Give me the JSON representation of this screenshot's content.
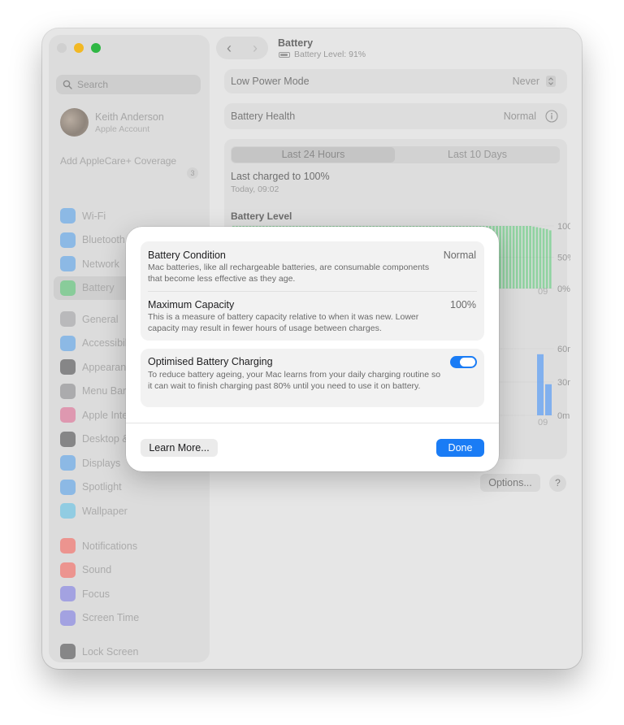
{
  "window": {
    "title": "Battery",
    "subtitle": "Battery Level: 91%"
  },
  "sidebar": {
    "search_placeholder": "Search",
    "account": {
      "name": "Keith Anderson",
      "subtitle": "Apple Account"
    },
    "applecare": {
      "label": "Add AppleCare+ Coverage",
      "badge": "3"
    },
    "groups": [
      [
        {
          "label": "Wi-Fi",
          "icon": "wifi-icon",
          "color": "#2b8ff0"
        },
        {
          "label": "Bluetooth",
          "icon": "bluetooth-icon",
          "color": "#2b8ff0"
        },
        {
          "label": "Network",
          "icon": "network-icon",
          "color": "#2b8ff0"
        },
        {
          "label": "Battery",
          "icon": "battery-icon",
          "color": "#33c759",
          "selected": true
        }
      ],
      [
        {
          "label": "General",
          "icon": "gear-icon",
          "color": "#8e8e93"
        },
        {
          "label": "Accessibility",
          "icon": "accessibility-icon",
          "color": "#2b8ff0"
        },
        {
          "label": "Appearance",
          "icon": "appearance-icon",
          "color": "#1c1c1e"
        },
        {
          "label": "Menu Bar",
          "icon": "menu-bar-icon",
          "color": "#6e6e73"
        },
        {
          "label": "Apple Intelligence & Siri",
          "icon": "siri-icon",
          "color": "#e0457b"
        },
        {
          "label": "Desktop & Dock",
          "icon": "desktop-dock-icon",
          "color": "#1c1c1e"
        },
        {
          "label": "Displays",
          "icon": "displays-icon",
          "color": "#2b8ff0"
        },
        {
          "label": "Spotlight",
          "icon": "spotlight-icon",
          "color": "#2b8ff0"
        },
        {
          "label": "Wallpaper",
          "icon": "wallpaper-icon",
          "color": "#35b7e8"
        }
      ],
      [
        {
          "label": "Notifications",
          "icon": "notifications-icon",
          "color": "#ff3b30"
        },
        {
          "label": "Sound",
          "icon": "sound-icon",
          "color": "#ff3b30"
        },
        {
          "label": "Focus",
          "icon": "focus-icon",
          "color": "#5e5ce6"
        },
        {
          "label": "Screen Time",
          "icon": "screen-time-icon",
          "color": "#5e5ce6"
        }
      ],
      [
        {
          "label": "Lock Screen",
          "icon": "lock-icon",
          "color": "#1c1c1e"
        }
      ]
    ]
  },
  "main": {
    "low_power": {
      "label": "Low Power Mode",
      "value": "Never"
    },
    "health": {
      "label": "Battery Health",
      "value": "Normal"
    },
    "tabs": [
      "Last 24 Hours",
      "Last 10 Days"
    ],
    "last_charged": {
      "label": "Last charged to 100%",
      "time": "Today, 09:02"
    },
    "battery_level_title": "Battery Level",
    "options_button": "Options...",
    "help_button": "?"
  },
  "chart_data": [
    {
      "type": "bar",
      "title": "Battery Level",
      "y_tick_labels": [
        "100%",
        "50%",
        "0%"
      ],
      "ylim": [
        0,
        100
      ],
      "x_tick_labels": [
        "09"
      ],
      "color": "#34c759",
      "x": [
        0,
        1,
        2,
        3,
        4,
        5,
        6,
        7,
        8,
        9,
        10,
        11,
        12,
        13,
        14,
        15,
        16,
        17,
        18,
        19,
        20,
        21,
        22,
        23,
        24,
        25,
        26,
        27,
        28,
        29,
        30,
        31,
        32,
        33,
        34,
        35,
        36,
        37,
        38,
        39,
        40,
        41,
        42,
        43,
        44,
        45,
        46,
        47,
        48,
        49,
        50,
        51,
        52,
        53,
        54,
        55,
        56,
        57,
        58,
        59,
        60,
        61,
        62,
        63,
        64,
        65,
        66,
        67,
        68,
        69,
        70,
        71,
        72,
        73,
        74,
        75,
        76,
        77,
        78,
        79,
        80,
        81,
        82,
        83,
        84,
        85,
        86,
        87,
        88,
        89,
        90,
        91,
        92,
        93,
        94,
        95
      ],
      "values": [
        100,
        100,
        100,
        100,
        100,
        100,
        100,
        100,
        100,
        100,
        100,
        100,
        100,
        100,
        100,
        100,
        100,
        100,
        100,
        100,
        100,
        100,
        100,
        100,
        100,
        100,
        100,
        100,
        100,
        100,
        100,
        100,
        100,
        100,
        100,
        100,
        100,
        100,
        100,
        100,
        100,
        100,
        100,
        100,
        100,
        100,
        100,
        100,
        100,
        100,
        100,
        100,
        100,
        100,
        100,
        100,
        100,
        100,
        100,
        100,
        100,
        100,
        100,
        100,
        100,
        100,
        100,
        100,
        100,
        100,
        100,
        100,
        100,
        100,
        100,
        100,
        100,
        100,
        100,
        100,
        100,
        100,
        100,
        100,
        100,
        100,
        100,
        100,
        100,
        100,
        99,
        98,
        97,
        96,
        95,
        93
      ]
    },
    {
      "type": "bar",
      "y_tick_labels": [
        "60m",
        "30m",
        "0m"
      ],
      "ylim": [
        0,
        60
      ],
      "x_tick_labels": [
        "09"
      ],
      "color": "#5a9cf5",
      "x": [
        0,
        1
      ],
      "values": [
        55,
        28
      ]
    }
  ],
  "dialog": {
    "condition": {
      "title": "Battery Condition",
      "value": "Normal",
      "desc": "Mac batteries, like all rechargeable batteries, are consumable components that become less effective as they age."
    },
    "capacity": {
      "title": "Maximum Capacity",
      "value": "100%",
      "desc": "This is a measure of battery capacity relative to when it was new. Lower capacity may result in fewer hours of usage between charges."
    },
    "optimised": {
      "title": "Optimised Battery Charging",
      "enabled": true,
      "desc": "To reduce battery ageing, your Mac learns from your daily charging routine so it can wait to finish charging past 80% until you need to use it on battery."
    },
    "learn_more": "Learn More...",
    "done": "Done",
    "accent": "#1a7cf5"
  }
}
